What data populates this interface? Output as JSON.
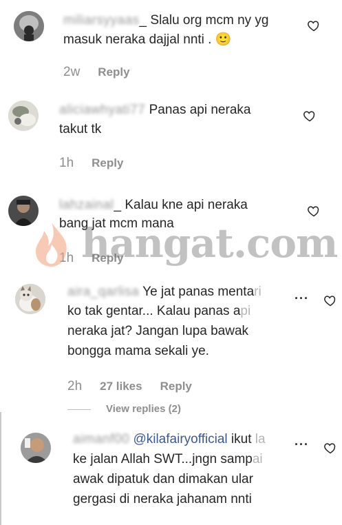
{
  "comments": [
    {
      "username": "miliarsyyaas",
      "text_line1": "Slalu org mcm ny yg",
      "text_line2": "masuk neraka dajjal nnti .",
      "emoji": "🙂",
      "age": "2w",
      "reply_label": "Reply"
    },
    {
      "username": "aliciawhyati77",
      "text_line1": "Panas api neraka",
      "text_line2": "takut tk",
      "age": "1h",
      "reply_label": "Reply"
    },
    {
      "username": "lahzainal",
      "text_line1": "Kalau kne api neraka",
      "text_line2": "bang jat mcm mana",
      "age": "1h",
      "reply_label": "Reply"
    },
    {
      "username": "aira_qarlisa",
      "text_line1": "Ye jat panas menta",
      "text_line1_fade": "ri",
      "text_line2": "ko tak gentar... Kalau panas a",
      "text_line2_fade": "pi",
      "text_line3": "neraka jat? Jangan lupa bawak",
      "text_line4": "bongga mama sekali ye.",
      "age": "2h",
      "likes": "27 likes",
      "reply_label": "Reply",
      "view_replies": "View replies (2)",
      "more_label": "..."
    },
    {
      "username": "aimanf00",
      "mention": "@kilafairyofficial",
      "text_line1_tail": " ikut ",
      "text_line1_fade": "la",
      "text_line2": "ke jalan Allah SWT...jngn samp",
      "text_line2_fade": "ai",
      "text_line3": "awak dipatuk dan dimakan ular",
      "text_line4": "gergasi di neraka jahanam nnti",
      "more_label": "..."
    }
  ],
  "watermark": {
    "text": "hangat.com"
  },
  "colors": {
    "text": "#262626",
    "meta": "#8e8e8e",
    "mention": "#385898"
  }
}
